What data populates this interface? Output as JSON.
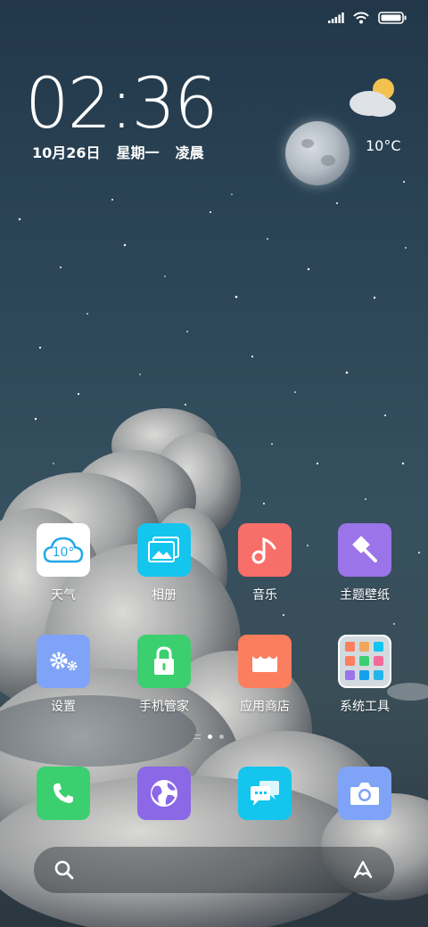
{
  "status_bar": {
    "signal_icon": "signal-bars-icon",
    "wifi_icon": "wifi-icon",
    "battery_icon": "battery-full-icon"
  },
  "clock": {
    "time": "02:36",
    "date": "10月26日",
    "weekday": "星期一",
    "period": "凌晨"
  },
  "weather": {
    "icon": "partly-cloudy-icon",
    "temperature": "10°C"
  },
  "apps": [
    {
      "label": "天气",
      "icon": "weather-icon",
      "icon_text": "10°",
      "color": "#ffffff"
    },
    {
      "label": "相册",
      "icon": "gallery-icon",
      "color": "#14c5ee"
    },
    {
      "label": "音乐",
      "icon": "music-note-icon",
      "color": "#f86f6a"
    },
    {
      "label": "主题壁纸",
      "icon": "paint-brush-icon",
      "color": "#9a74e8"
    },
    {
      "label": "设置",
      "icon": "gears-icon",
      "color": "#7fa3f6"
    },
    {
      "label": "手机管家",
      "icon": "lock-icon",
      "color": "#3ccf70"
    },
    {
      "label": "应用商店",
      "icon": "store-icon",
      "color": "#fb7f5e"
    },
    {
      "label": "系统工具",
      "icon": "folder-icon",
      "color": "#dfe6ec"
    }
  ],
  "page_indicator": {
    "pages": 2,
    "active": 1
  },
  "dock": [
    {
      "icon": "phone-icon",
      "color": "#3ccf70"
    },
    {
      "icon": "browser-icon",
      "color": "#8a68e6"
    },
    {
      "icon": "messages-icon",
      "color": "#14c5ee"
    },
    {
      "icon": "camera-icon",
      "color": "#7fa3f6"
    }
  ],
  "search_bar": {
    "search_icon": "search-icon",
    "assistant_icon": "assistant-icon"
  }
}
